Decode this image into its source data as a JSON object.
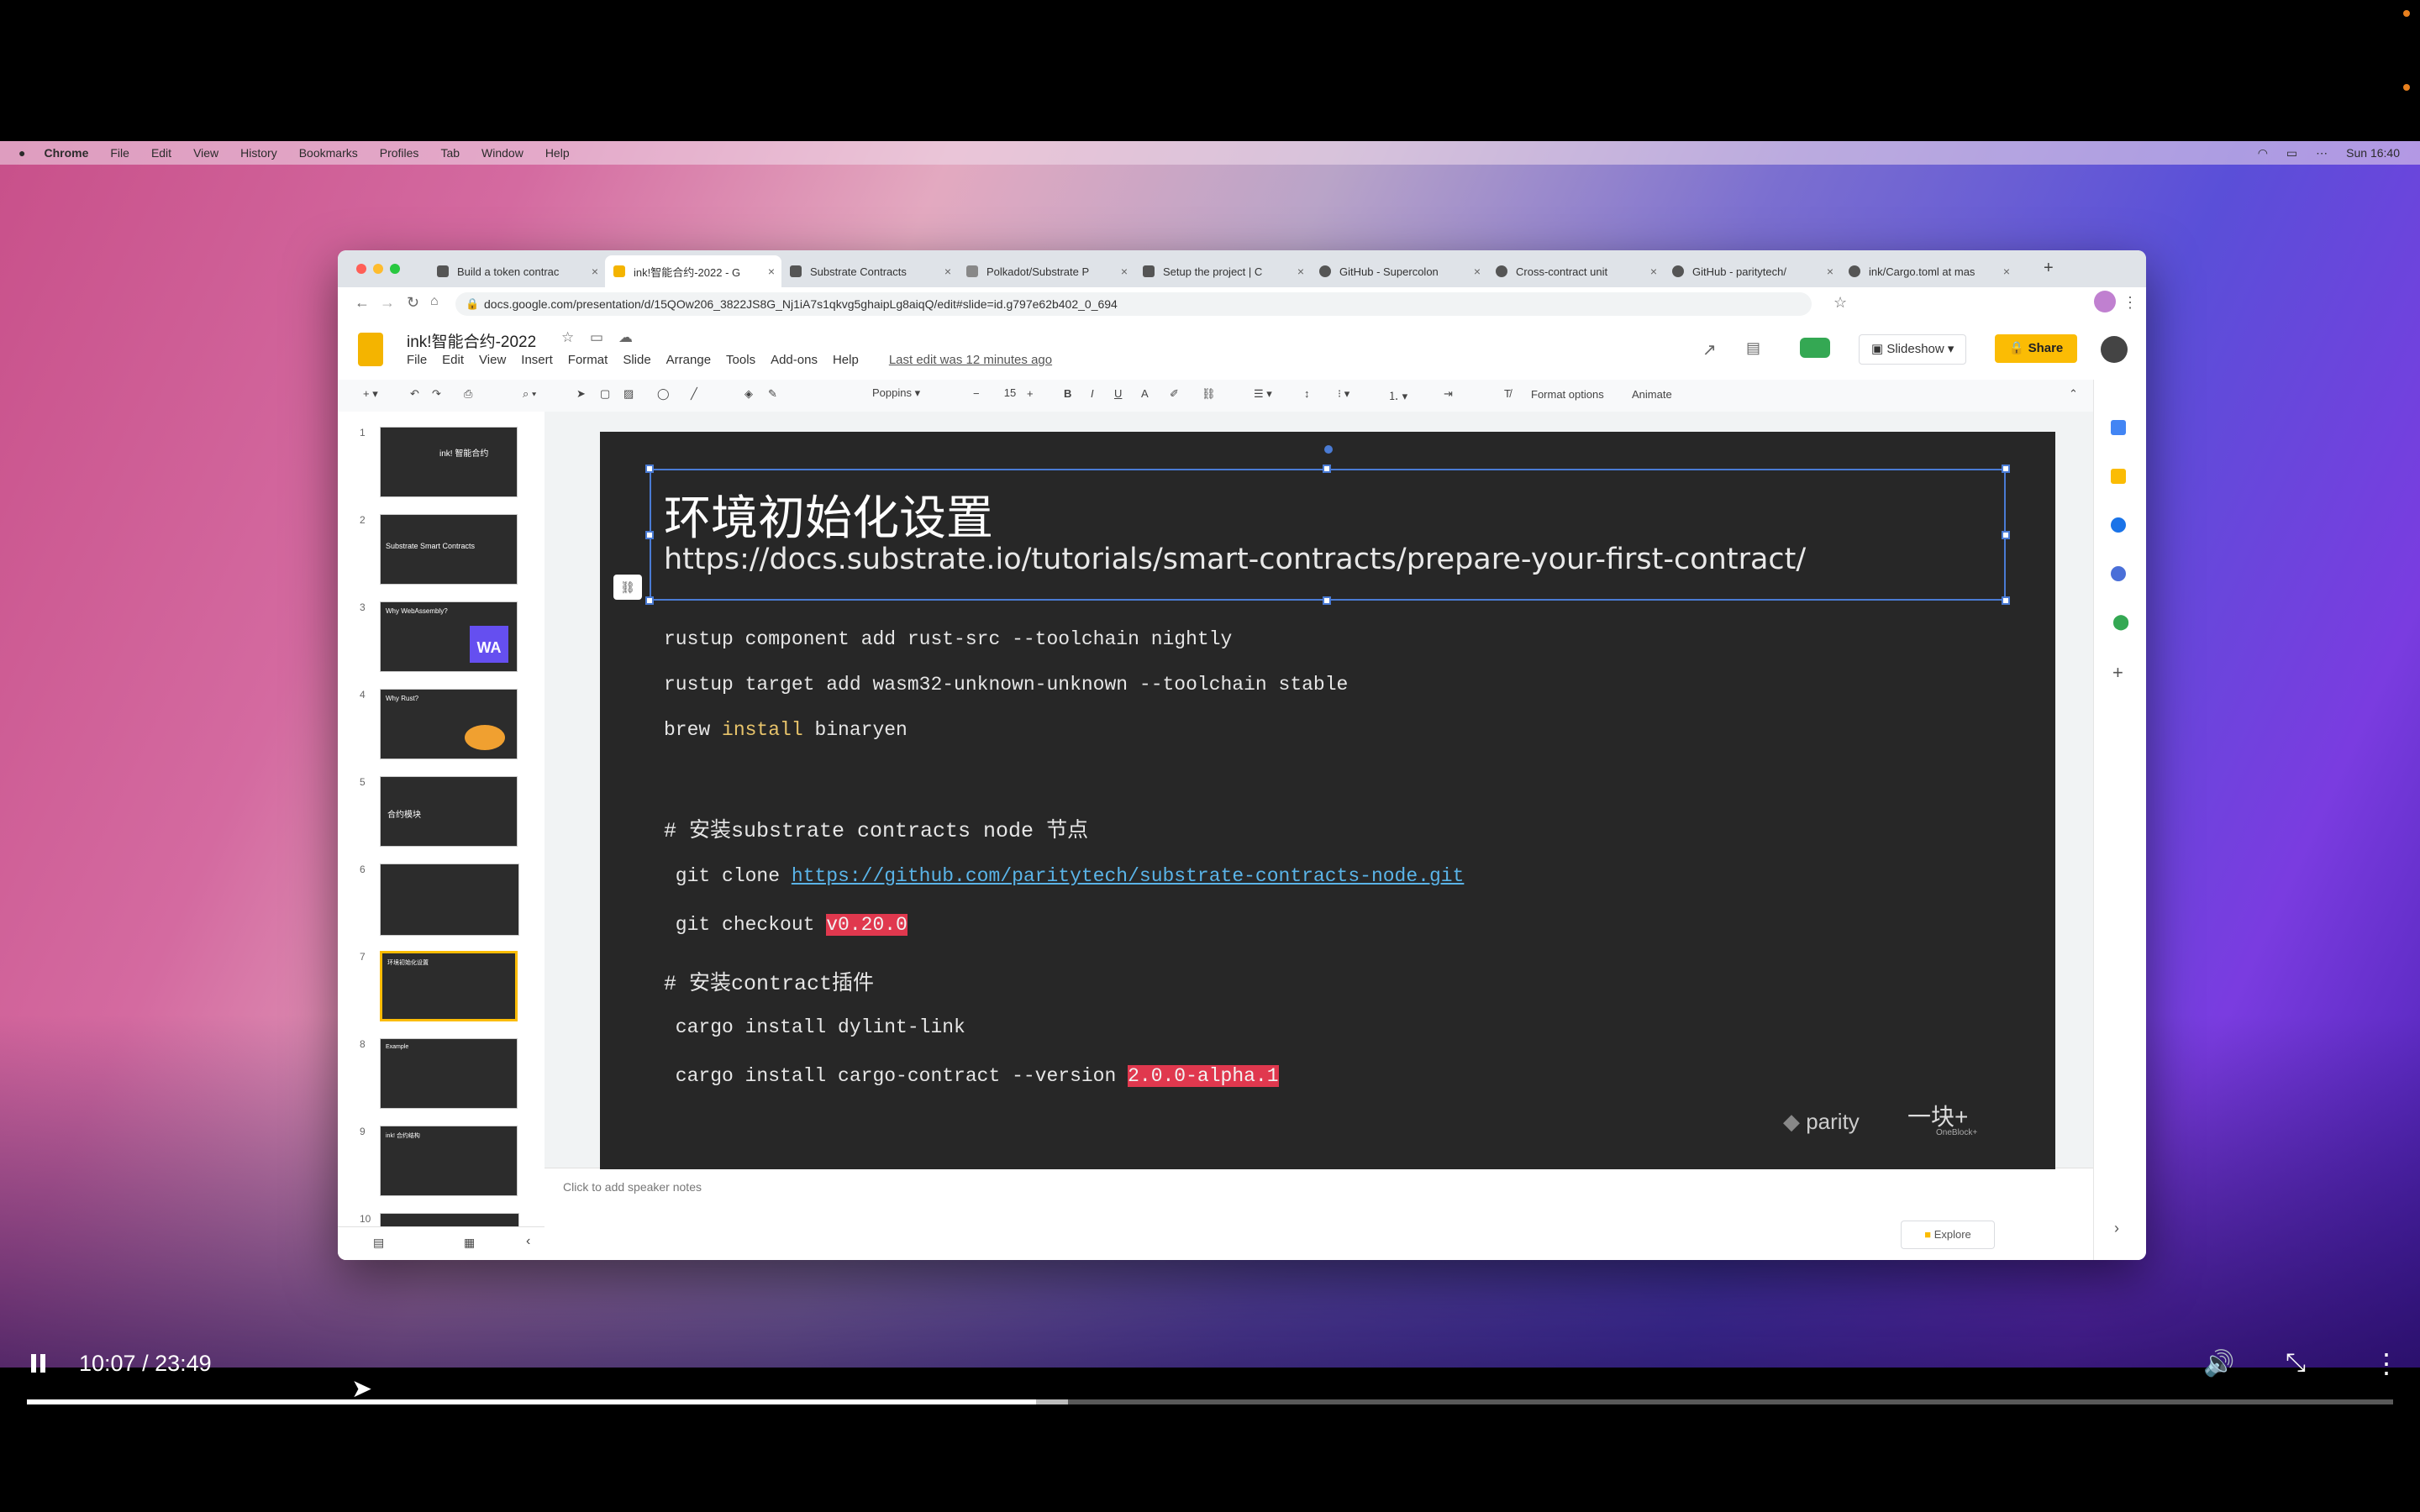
{
  "menubar": {
    "items": [
      "Chrome",
      "File",
      "Edit",
      "View",
      "History",
      "Bookmarks",
      "Profiles",
      "Tab",
      "Window",
      "Help"
    ],
    "clock": "Sun 16:40"
  },
  "browser": {
    "tabs": [
      {
        "label": "Build a token contrac"
      },
      {
        "label": "ink!智能合约-2022 - G"
      },
      {
        "label": "Substrate Contracts"
      },
      {
        "label": "Polkadot/Substrate P"
      },
      {
        "label": "Setup the project | C"
      },
      {
        "label": "GitHub - Supercolon"
      },
      {
        "label": "Cross-contract unit"
      },
      {
        "label": "GitHub - paritytech/"
      },
      {
        "label": "ink/Cargo.toml at mas"
      }
    ],
    "url": "docs.google.com/presentation/d/15QOw206_3822JS8G_Nj1iA7s1qkvg5ghaipLg8aiqQ/edit#slide=id.g797e62b402_0_694"
  },
  "slides_app": {
    "doc_title": "ink!智能合约-2022",
    "menus": [
      "File",
      "Edit",
      "View",
      "Insert",
      "Format",
      "Slide",
      "Arrange",
      "Tools",
      "Add-ons",
      "Help"
    ],
    "last_edit": "Last edit was 12 minutes ago",
    "slideshow_label": "Slideshow",
    "share_label": "Share",
    "toolbar": {
      "font": "Poppins",
      "font_size": "15",
      "format_options": "Format options",
      "animate": "Animate"
    },
    "thumbnails": [
      {
        "num": "1",
        "text": "ink! 智能合约"
      },
      {
        "num": "2",
        "text": "Substrate Smart Contracts"
      },
      {
        "num": "3",
        "text": "Why WebAssembly?"
      },
      {
        "num": "4",
        "text": "Why Rust?"
      },
      {
        "num": "5",
        "text": "合约模块"
      },
      {
        "num": "6",
        "text": ""
      },
      {
        "num": "7",
        "text": "环境初始化设置"
      },
      {
        "num": "8",
        "text": "Example"
      },
      {
        "num": "9",
        "text": "ink! 合约结构"
      },
      {
        "num": "10",
        "text": ""
      }
    ],
    "notes_placeholder": "Click to add speaker notes",
    "explore_label": "Explore"
  },
  "slide": {
    "title": "环境初始化设置",
    "link": "https://docs.substrate.io/tutorials/smart-contracts/prepare-your-first-contract/",
    "lines": {
      "l1": "rustup component add rust-src --toolchain nightly",
      "l2": "rustup target add wasm32-unknown-unknown --toolchain stable",
      "l3_a": "brew ",
      "l3_b": "install",
      "l3_c": " binaryen",
      "h1": "# 安装substrate contracts node 节点",
      "l4_a": " git clone ",
      "l4_b": "https://github.com/paritytech/substrate-contracts-node.git",
      "l5_a": " git checkout ",
      "l5_b": "v0.20.0",
      "h2": "# 安装contract插件",
      "l6": " cargo install dylint-link",
      "l7_a": " cargo install cargo-contract --version ",
      "l7_b": "2.0.0-alpha.1"
    },
    "logo_parity": "parity",
    "logo_oneblock": "一块+",
    "logo_oneblock_sub": "OneBlock+"
  },
  "video": {
    "time": "10:07 / 23:49",
    "progress": 0.4265,
    "buffered": 0.44
  },
  "colors": {
    "accent_share": "#fbbc04",
    "highlight_red": "#e0384e",
    "link_blue": "#5ab4e8",
    "selection": "#4a7bd4"
  }
}
